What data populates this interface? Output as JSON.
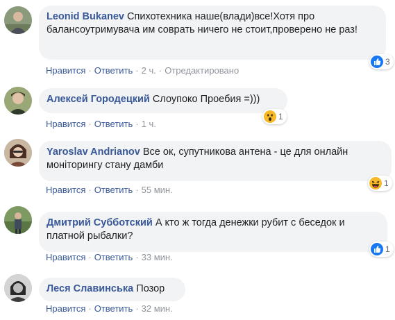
{
  "comments": [
    {
      "author": "Leonid Bukanev",
      "text": "Спихотехника наше(влади)все!Хотя про балансоутримувача им соврать ничего не стоит,проверено не раз!",
      "like": "Нравится",
      "reply": "Ответить",
      "time": "2 ч.",
      "edited": "Отредактировано",
      "reaction_icon": "like-icon",
      "reaction_count": "3"
    },
    {
      "author": "Алексей Городецкий",
      "text": "Слоупоко Проебия =)))",
      "like": "Нравится",
      "reply": "Ответить",
      "time": "1 ч.",
      "reaction_icon": "wow-icon",
      "reaction_count": "1"
    },
    {
      "author": "Yaroslav Andrianov",
      "text": "Все ок, супутникова антена - це для онлайн моніторингу стану дамби",
      "like": "Нравится",
      "reply": "Ответить",
      "time": "55 мин.",
      "reaction_icon": "haha-icon",
      "reaction_count": "1"
    },
    {
      "author": "Дмитрий Субботский",
      "text": "А кто ж тогда денежки рубит с беседок и платной рыбалки?",
      "like": "Нравится",
      "reply": "Ответить",
      "time": "33 мин.",
      "reaction_icon": "like-icon",
      "reaction_count": "1"
    },
    {
      "author": "Леся Славинська",
      "text": "Позор",
      "like": "Нравится",
      "reply": "Ответить",
      "time": "32 мин."
    }
  ],
  "colors": {
    "author": "#385898",
    "bubble": "#f2f3f5",
    "like_blue": "#1877f2",
    "emoji_yellow": "#f7b928",
    "meta_gray": "#90949c"
  }
}
